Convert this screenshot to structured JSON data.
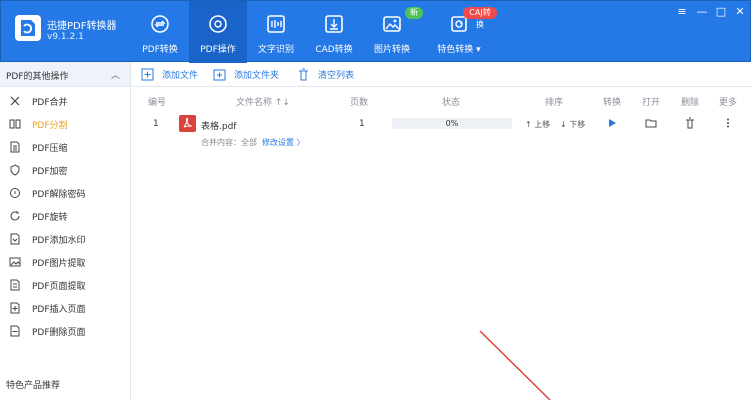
{
  "app": {
    "name": "迅捷PDF转换器",
    "version": "v9.1.2.1"
  },
  "nav": [
    {
      "label": "PDF转换",
      "icon": "refresh-doc-icon"
    },
    {
      "label": "PDF操作",
      "icon": "pdf-gear-icon",
      "active": true
    },
    {
      "label": "文字识别",
      "icon": "ocr-icon"
    },
    {
      "label": "CAD转换",
      "icon": "cad-icon"
    },
    {
      "label": "图片转换",
      "icon": "image-icon",
      "badge": "新"
    },
    {
      "label": "特色转换 ▾",
      "icon": "special-icon",
      "badge": "CAJ转换"
    }
  ],
  "window_controls": {
    "menu": "≡",
    "minimize": "—",
    "maximize": "□",
    "close": "✕"
  },
  "sidebar": {
    "header": "PDF的其他操作",
    "chevron": "︿",
    "items": [
      {
        "label": "PDF合并",
        "icon": "merge-icon"
      },
      {
        "label": "PDF分割",
        "icon": "split-icon"
      },
      {
        "label": "PDF压缩",
        "icon": "compress-icon"
      },
      {
        "label": "PDF加密",
        "icon": "lock-icon"
      },
      {
        "label": "PDF解除密码",
        "icon": "unlock-icon"
      },
      {
        "label": "PDF旋转",
        "icon": "rotate-icon"
      },
      {
        "label": "PDF添加水印",
        "icon": "watermark-icon"
      },
      {
        "label": "PDF图片提取",
        "icon": "image-extract-icon"
      },
      {
        "label": "PDF页面提取",
        "icon": "page-extract-icon"
      },
      {
        "label": "PDF插入页面",
        "icon": "page-insert-icon"
      },
      {
        "label": "PDF删除页面",
        "icon": "page-delete-icon"
      }
    ],
    "footer": "特色产品推荐"
  },
  "toolbar": {
    "add_file": "添加文件",
    "add_folder": "添加文件夹",
    "clear_list": "清空列表"
  },
  "table": {
    "headers": {
      "num": "编号",
      "name": "文件名称 ↑↓",
      "pages": "页数",
      "status": "状态",
      "sort": "排序",
      "convert": "转换",
      "open": "打开",
      "delete": "删除",
      "more": "更多"
    },
    "rows": [
      {
        "num": "1",
        "name": "表格.pdf",
        "pages": "1",
        "status": "0%",
        "progress": 0,
        "move_up": "↑ 上移",
        "move_down": "↓ 下移",
        "merge_label": "合并内容：全部",
        "modify_link": "修改设置 〉"
      }
    ]
  },
  "colors": {
    "header_bg": "#2479e6",
    "accent": "#2479e6",
    "active_orange": "#e8a227",
    "pdf_red": "#d9433b",
    "annotation_line": "#e03a2f"
  }
}
